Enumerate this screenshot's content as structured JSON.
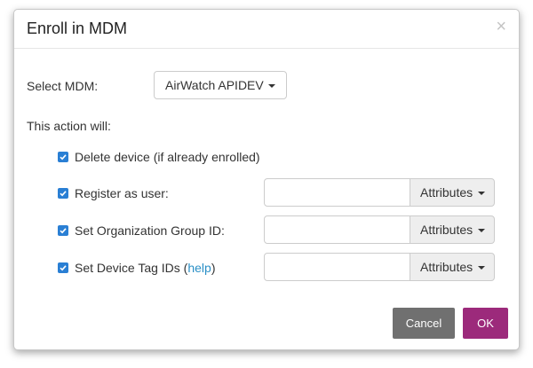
{
  "dialog": {
    "title": "Enroll in MDM",
    "close_glyph": "×"
  },
  "mdm": {
    "label": "Select MDM:",
    "selected": "AirWatch APIDEV"
  },
  "actions": {
    "heading": "This action will:",
    "items": [
      {
        "label": "Delete device (if already enrolled)",
        "checked": true
      },
      {
        "label": "Register as user:",
        "checked": true,
        "input_value": "",
        "attr_label": "Attributes"
      },
      {
        "label": "Set Organization Group ID:",
        "checked": true,
        "input_value": "",
        "attr_label": "Attributes"
      },
      {
        "label_prefix": "Set Device Tag IDs (",
        "link": "help",
        "label_suffix": ")",
        "checked": true,
        "input_value": "",
        "attr_label": "Attributes"
      }
    ]
  },
  "footer": {
    "cancel_label": "Cancel",
    "ok_label": "OK"
  },
  "colors": {
    "checkbox": "#2a7fd4",
    "ok_button": "#9c2a7b",
    "cancel_button": "#707070",
    "link": "#2a8fc6"
  },
  "icons": {
    "close": "close-icon",
    "dropdown": "caret-down-icon",
    "check": "checkmark-icon"
  }
}
